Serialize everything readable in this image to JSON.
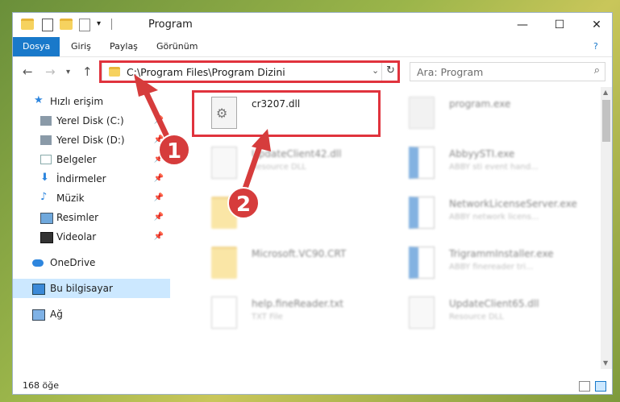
{
  "window": {
    "title": "Program",
    "controls": {
      "minimize": "—",
      "maximize": "☐",
      "close": "✕"
    }
  },
  "ribbon": {
    "tabs": [
      "Dosya",
      "Giriş",
      "Paylaş",
      "Görünüm"
    ],
    "active_tab": "Dosya",
    "help": "?"
  },
  "address": {
    "path": "C:\\Program Files\\Program Dizini",
    "search_placeholder": "Ara: Program"
  },
  "sidebar": {
    "items": [
      {
        "label": "Hızlı erişim",
        "icon": "star-icon"
      },
      {
        "label": "Yerel Disk (C:)",
        "icon": "drive-icon"
      },
      {
        "label": "Yerel Disk (D:)",
        "icon": "drive-icon"
      },
      {
        "label": "Belgeler",
        "icon": "documents-icon"
      },
      {
        "label": "İndirmeler",
        "icon": "download-icon"
      },
      {
        "label": "Müzik",
        "icon": "music-icon"
      },
      {
        "label": "Resimler",
        "icon": "pictures-icon"
      },
      {
        "label": "Videolar",
        "icon": "videos-icon"
      },
      {
        "label": "OneDrive",
        "icon": "cloud-icon"
      },
      {
        "label": "Bu bilgisayar",
        "icon": "computer-icon"
      },
      {
        "label": "Ağ",
        "icon": "network-icon"
      }
    ]
  },
  "files": [
    {
      "name": "cr3207.dll",
      "desc": ""
    },
    {
      "name": "program.exe",
      "desc": ""
    },
    {
      "name": "UpdateClient42.dll",
      "desc": "Resource DLL"
    },
    {
      "name": "AbbyySTI.exe",
      "desc": "ABBY sti event hand..."
    },
    {
      "name": "",
      "desc": ""
    },
    {
      "name": "NetworkLicenseServer.exe",
      "desc": "ABBY network licens..."
    },
    {
      "name": "Microsoft.VC90.CRT",
      "desc": ""
    },
    {
      "name": "TrigrammInstaller.exe",
      "desc": "ABBY finereader tri..."
    },
    {
      "name": "help.fineReader.txt",
      "desc": "TXT File"
    },
    {
      "name": "UpdateClient65.dll",
      "desc": "Resource DLL"
    }
  ],
  "status": {
    "count": "168 öğe"
  },
  "annotations": {
    "badge1": "1",
    "badge2": "2"
  },
  "colors": {
    "accent": "#1979ca",
    "highlight": "#e0333d",
    "selected": "#cce8ff"
  }
}
